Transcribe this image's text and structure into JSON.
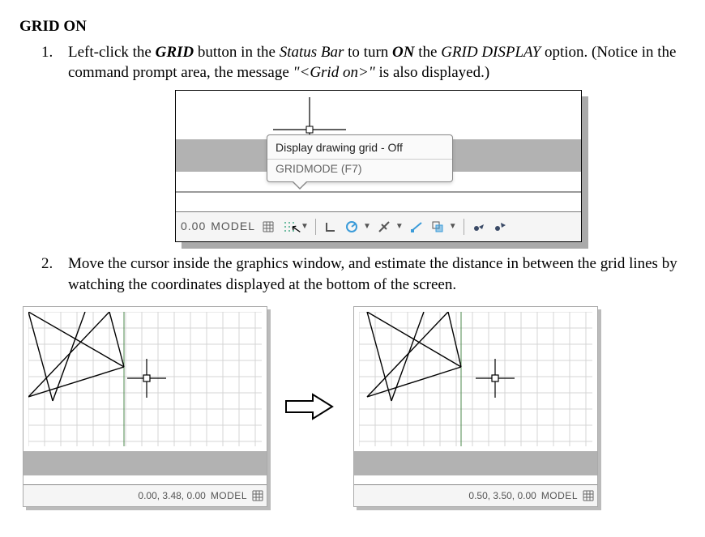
{
  "heading": "GRID ON",
  "steps": [
    {
      "pre": "Left-click the ",
      "grid": "GRID",
      "mid1": " button in the ",
      "statusbar": "Status Bar",
      "mid2": " to turn ",
      "on": "ON",
      "mid3": " the ",
      "display": "GRID DISPLAY",
      "mid4": " option. (Notice in the command prompt area, the message ",
      "msg": "\"<Grid on>\"",
      "end": " is also displayed.)"
    },
    {
      "text": "Move the cursor inside the graphics window, and estimate the distance in between the grid lines by watching the coordinates displayed at the bottom of the screen."
    }
  ],
  "fig1": {
    "tooltip_title": "Display drawing grid - Off",
    "tooltip_sub": "GRIDMODE (F7)",
    "coord": "0.00",
    "model": "MODEL",
    "icons": {
      "grid": "grid-icon",
      "griddots": "grid-dots-icon",
      "ortho": "ortho-icon",
      "polar": "polar-icon",
      "snap": "snap-icon",
      "lineweight": "lineweight-icon",
      "transparency": "transparency-icon",
      "sel": "selection-icon",
      "ann": "annotation-icon"
    }
  },
  "fig2a": {
    "coord": "0.00, 3.48, 0.00",
    "model": "MODEL",
    "grid_icon": "grid-icon"
  },
  "fig2b": {
    "coord": "0.50, 3.50, 0.00",
    "model": "MODEL",
    "grid_icon": "grid-icon"
  }
}
